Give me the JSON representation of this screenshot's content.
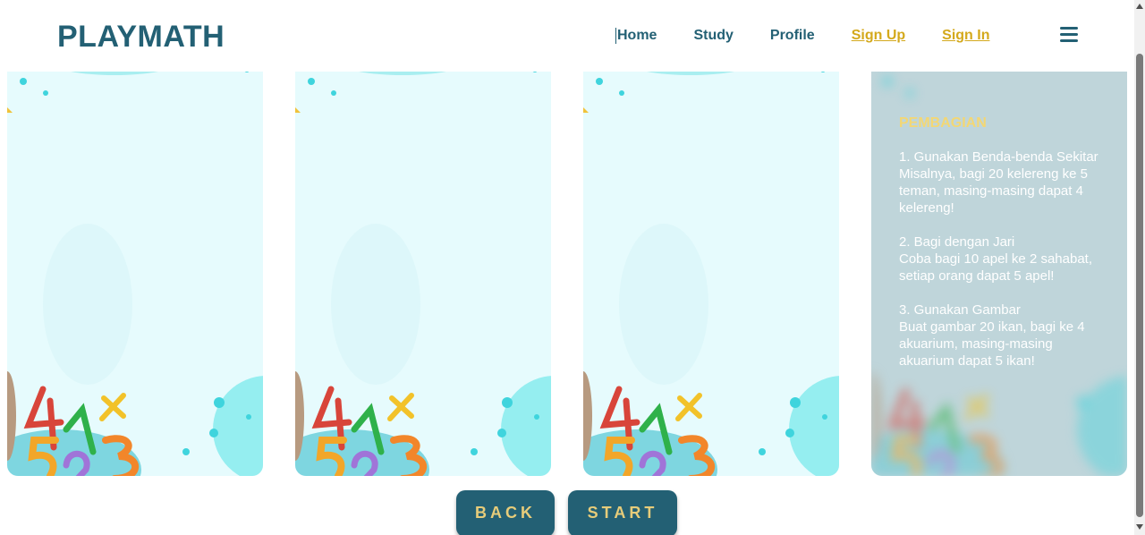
{
  "header": {
    "logo": "PLAYMATH",
    "nav": [
      {
        "label": "Home"
      },
      {
        "label": "Study"
      },
      {
        "label": "Profile"
      },
      {
        "label": "Sign Up"
      },
      {
        "label": "Sign In"
      }
    ],
    "menu_icon": "hamburger-icon"
  },
  "info_card": {
    "title": "PEMBAGIAN",
    "tips": [
      {
        "heading": "1. Gunakan Benda-benda Sekitar",
        "body": "Misalnya, bagi 20 kelereng ke 5 teman, masing-masing dapat 4 kelereng!"
      },
      {
        "heading": "2. Bagi dengan Jari",
        "body": "Coba bagi 10 apel ke 2 sahabat, setiap orang dapat 5 apel!"
      },
      {
        "heading": "3. Gunakan Gambar",
        "body": "Buat gambar 20 ikan, bagi ke 4 akuarium, masing-masing akuarium dapat 5 ikan!"
      }
    ]
  },
  "buttons": {
    "back": "BACK",
    "start": "START"
  },
  "colors": {
    "primary": "#236074",
    "accent": "#d4a91c",
    "button_text": "#e6cc7a",
    "card_bg": "#e6fbfd",
    "info_title": "#f3d774"
  }
}
